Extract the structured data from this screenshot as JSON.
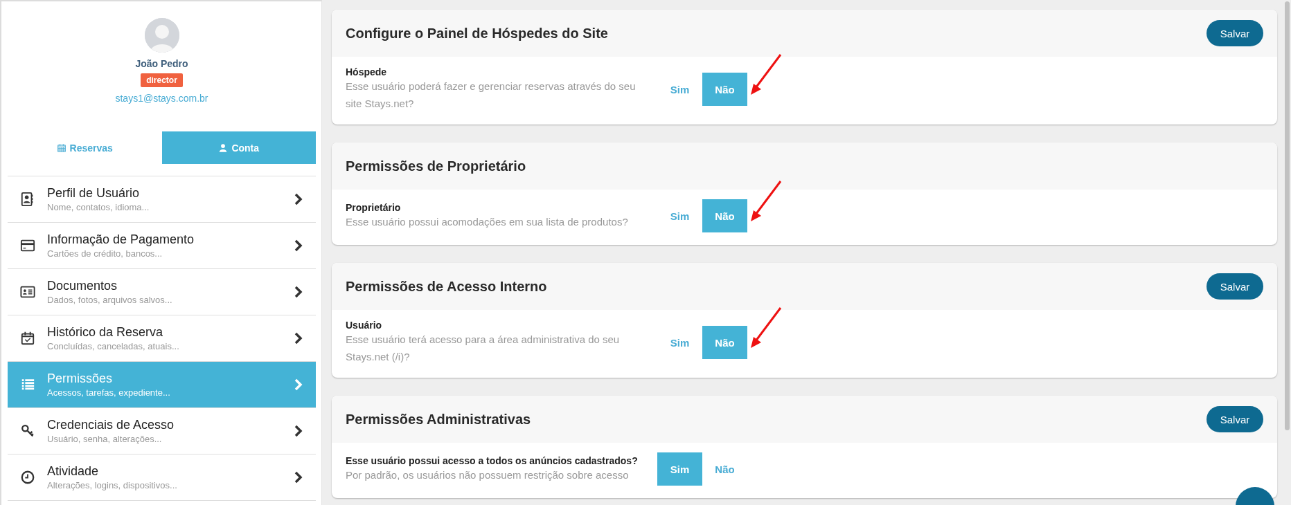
{
  "profile": {
    "name": "João Pedro",
    "role": "director",
    "email": "stays1@stays.com.br"
  },
  "tabs": [
    {
      "label": "Reservas",
      "selected": false
    },
    {
      "label": "Conta",
      "selected": true
    }
  ],
  "menu": [
    {
      "title": "Perfil de Usuário",
      "subtitle": "Nome, contatos, idioma...",
      "selected": false
    },
    {
      "title": "Informação de Pagamento",
      "subtitle": "Cartões de crédito, bancos...",
      "selected": false
    },
    {
      "title": "Documentos",
      "subtitle": "Dados, fotos, arquivos salvos...",
      "selected": false
    },
    {
      "title": "Histórico da Reserva",
      "subtitle": "Concluídas, canceladas, atuais...",
      "selected": false
    },
    {
      "title": "Permissões",
      "subtitle": "Acessos, tarefas, expediente...",
      "selected": true
    },
    {
      "title": "Credenciais de Acesso",
      "subtitle": "Usuário, senha, alterações...",
      "selected": false
    },
    {
      "title": "Atividade",
      "subtitle": "Alterações, logins, dispositivos...",
      "selected": false
    }
  ],
  "sections": [
    {
      "title": "Configure o Painel de Hóspedes do Site",
      "save_button": "Salvar",
      "rows": [
        {
          "label": "Hóspede",
          "description": "Esse usuário poderá fazer e gerenciar reservas através do seu site Stays.net?",
          "annotated": true,
          "options": [
            {
              "label": "Sim",
              "selected": false
            },
            {
              "label": "Não",
              "selected": true
            }
          ]
        }
      ]
    },
    {
      "title": "Permissões de Proprietário",
      "rows": [
        {
          "label": "Proprietário",
          "description": "Esse usuário possui acomodações em sua lista de produtos?",
          "annotated": true,
          "options": [
            {
              "label": "Sim",
              "selected": false
            },
            {
              "label": "Não",
              "selected": true
            }
          ]
        }
      ]
    },
    {
      "title": "Permissões de Acesso Interno",
      "save_button": "Salvar",
      "rows": [
        {
          "label": "Usuário",
          "description": "Esse usuário terá acesso para a área administrativa do seu Stays.net (/i)?",
          "annotated": true,
          "options": [
            {
              "label": "Sim",
              "selected": false
            },
            {
              "label": "Não",
              "selected": true
            }
          ]
        }
      ]
    },
    {
      "title": "Permissões Administrativas",
      "save_button": "Salvar",
      "rows": [
        {
          "label": "Esse usuário possui acesso a todos os anúncios cadastrados?",
          "description": "Por padrão, os usuários não possuem restrição sobre acesso",
          "annotated": false,
          "options": [
            {
              "label": "Sim",
              "selected": true
            },
            {
              "label": "Não",
              "selected": false
            }
          ]
        }
      ]
    }
  ]
}
